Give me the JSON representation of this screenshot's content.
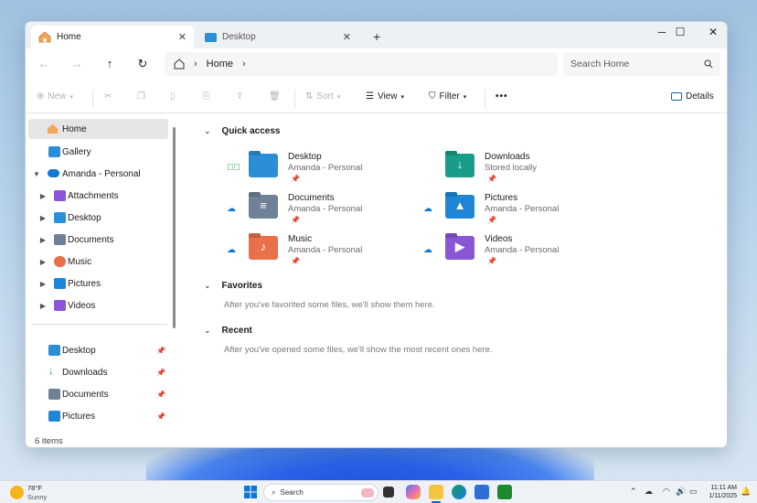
{
  "tabs": [
    {
      "label": "Home",
      "icon": "home-icon"
    },
    {
      "label": "Desktop",
      "icon": "desktop-folder-icon"
    }
  ],
  "address": {
    "crumb": "Home",
    "search_placeholder": "Search Home"
  },
  "toolbar": {
    "new_label": "New",
    "sort_label": "Sort",
    "view_label": "View",
    "filter_label": "Filter",
    "details_label": "Details"
  },
  "sidebar": {
    "top_items": [
      {
        "label": "Home"
      },
      {
        "label": "Gallery"
      },
      {
        "label": "Amanda - Personal"
      },
      {
        "label": "Attachments"
      },
      {
        "label": "Desktop"
      },
      {
        "label": "Documents"
      },
      {
        "label": "Music"
      },
      {
        "label": "Pictures"
      },
      {
        "label": "Videos"
      }
    ],
    "pinned_items": [
      {
        "label": "Desktop"
      },
      {
        "label": "Downloads"
      },
      {
        "label": "Documents"
      },
      {
        "label": "Pictures"
      }
    ]
  },
  "main": {
    "quick_access_title": "Quick access",
    "quick_access": [
      {
        "name": "Desktop",
        "location": "Amanda - Personal",
        "status": "synced"
      },
      {
        "name": "Downloads",
        "location": "Stored locally",
        "status": ""
      },
      {
        "name": "Documents",
        "location": "Amanda - Personal",
        "status": "cloud"
      },
      {
        "name": "Pictures",
        "location": "Amanda - Personal",
        "status": "cloud"
      },
      {
        "name": "Music",
        "location": "Amanda - Personal",
        "status": "cloud"
      },
      {
        "name": "Videos",
        "location": "Amanda - Personal",
        "status": "cloud"
      }
    ],
    "favorites_title": "Favorites",
    "favorites_note": "After you've favorited some files, we'll show them here.",
    "recent_title": "Recent",
    "recent_note": "After you've opened some files, we'll show the most recent ones here."
  },
  "status": {
    "item_count": "6 items"
  },
  "taskbar": {
    "temp": "78°F",
    "weather": "Sunny",
    "search_label": "Search",
    "time": "11:11 AM",
    "date": "1/11/2025"
  },
  "colors": {
    "accent": "#0067c0",
    "folder_blue": "#2b8fd8",
    "downloads_teal": "#1a9c8a",
    "music_orange": "#e8704a",
    "videos_purple": "#8a55d6"
  }
}
